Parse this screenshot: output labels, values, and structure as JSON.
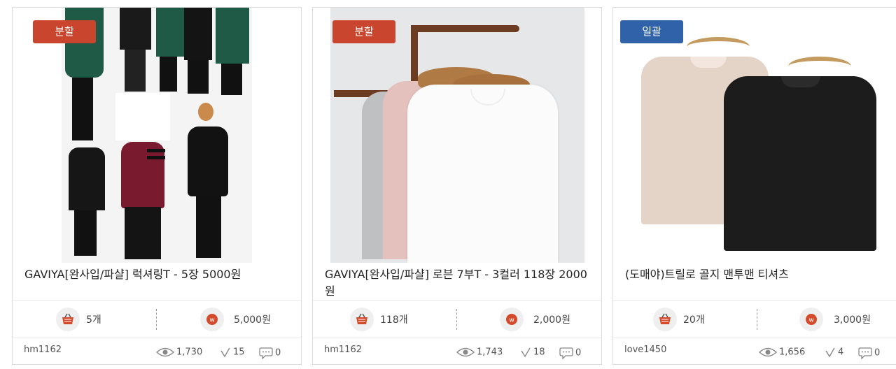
{
  "products": [
    {
      "badge": "분할",
      "badge_color": "#c9452d",
      "title": "GAVIYA[완사입/파샬] 럭셔링T - 5장 5000원",
      "quantity": "5개",
      "price": "5,000원",
      "seller": "hm1162",
      "views": "1,730",
      "likes": "15",
      "comments": "0"
    },
    {
      "badge": "분할",
      "badge_color": "#c9452d",
      "title": "GAVIYA[완사입/파샬] 로븐 7부T - 3컬러 118장 2000원",
      "quantity": "118개",
      "price": "2,000원",
      "seller": "hm1162",
      "views": "1,743",
      "likes": "18",
      "comments": "0"
    },
    {
      "badge": "일괄",
      "badge_color": "#2f62a8",
      "title": "(도매야)트릴로 골지 맨투맨 티셔츠",
      "quantity": "20개",
      "price": "3,000원",
      "seller": "love1450",
      "views": "1,656",
      "likes": "4",
      "comments": "0"
    }
  ],
  "icons": {
    "basket": "basket-icon",
    "price": "won-coin-icon",
    "views": "eye-icon",
    "likes": "check-icon",
    "comments": "speech-bubble-icon"
  }
}
